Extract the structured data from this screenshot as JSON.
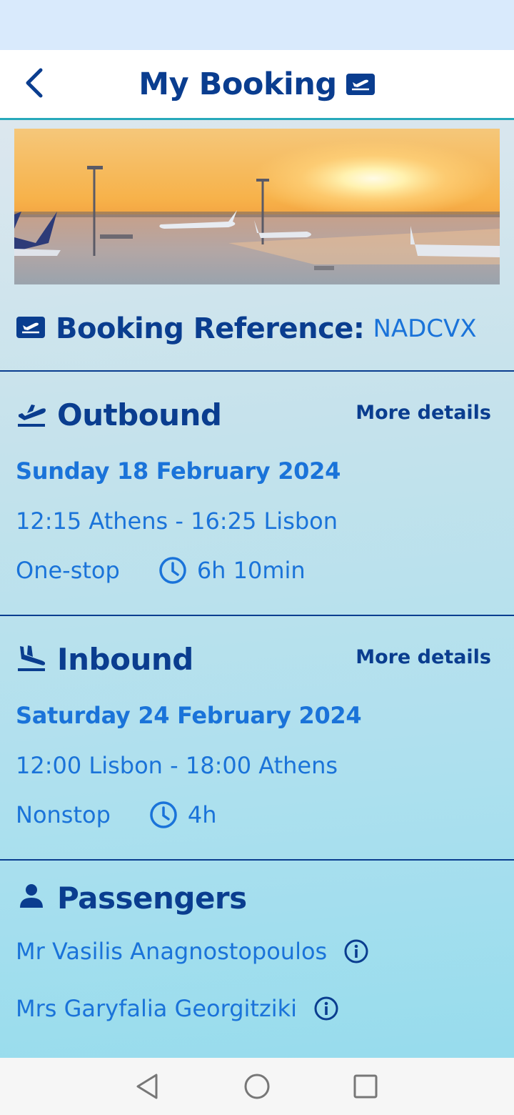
{
  "header": {
    "title": "My Booking"
  },
  "booking": {
    "ref_label": "Booking Reference:",
    "ref_value": "NADCVX"
  },
  "outbound": {
    "title": "Outbound",
    "more": "More details",
    "date": "Sunday 18 February 2024",
    "route": "12:15 Athens - 16:25 Lisbon",
    "stops": "One-stop",
    "duration": "6h 10min"
  },
  "inbound": {
    "title": "Inbound",
    "more": "More details",
    "date": "Saturday 24 February 2024",
    "route": "12:00 Lisbon - 18:00 Athens",
    "stops": "Nonstop",
    "duration": "4h"
  },
  "passengers": {
    "title": "Passengers",
    "list": [
      "Mr Vasilis Anagnostopoulos",
      "Mrs Garyfalia Georgitziki"
    ]
  },
  "icons": {
    "back": "chevron-left-icon",
    "ticket": "flight-ticket-icon",
    "takeoff": "flight-takeoff-icon",
    "landing": "flight-land-icon",
    "clock": "clock-icon",
    "person": "person-icon",
    "info": "info-icon",
    "nav_back": "triangle-back-icon",
    "nav_home": "circle-home-icon",
    "nav_recent": "square-recent-icon"
  },
  "colors": {
    "primary": "#0a3d8f",
    "accent": "#1a73d9",
    "header_underline": "#27a9bb",
    "status_bar": "#d9eafc"
  }
}
